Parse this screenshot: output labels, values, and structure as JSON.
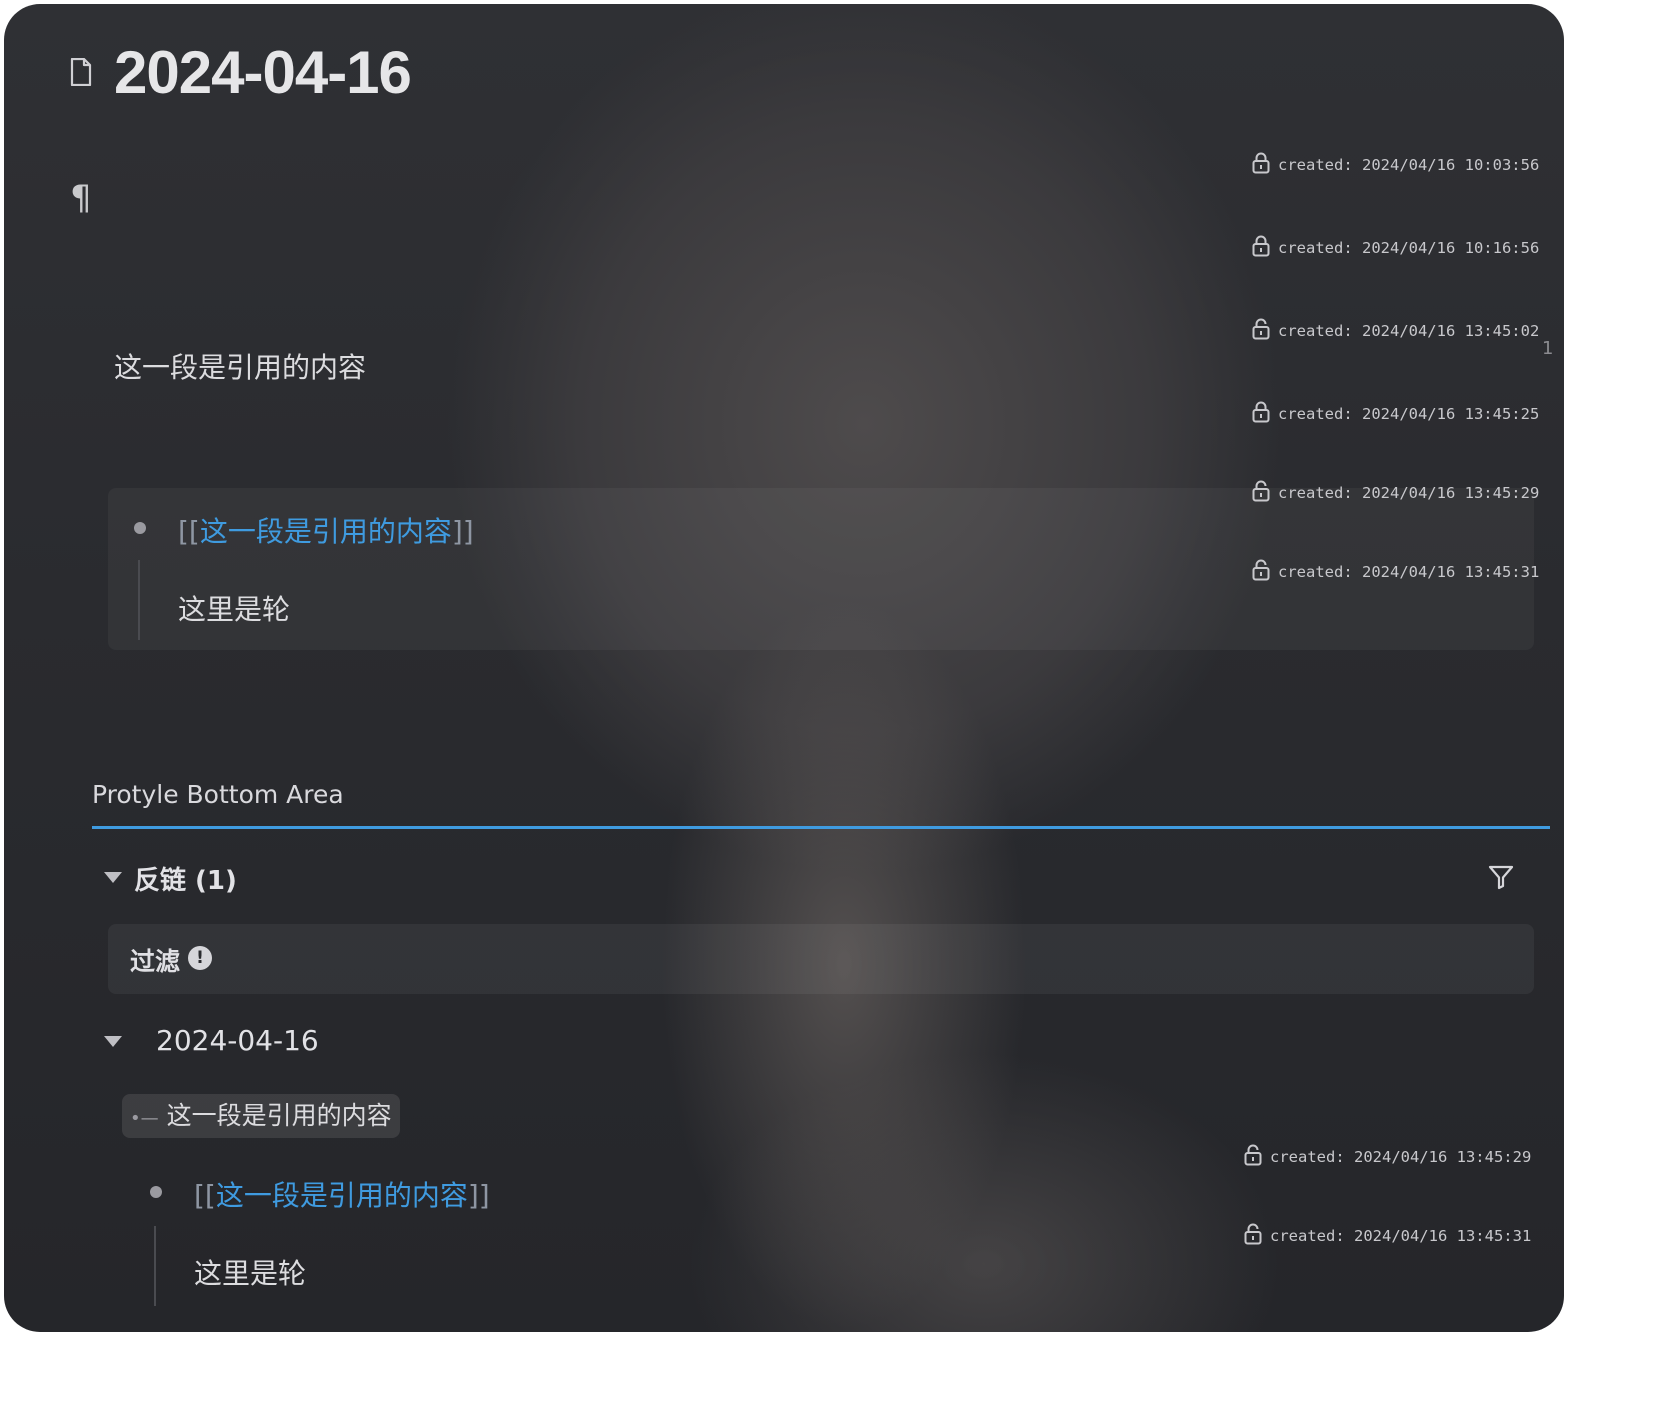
{
  "document": {
    "title": "2024-04-16",
    "paragraph_1": "这一段是引用的内容",
    "list": {
      "ref_open": "[[",
      "ref_text": "这一段是引用的内容",
      "ref_close": "]]",
      "child_text": "这里是轮"
    },
    "block_meta": [
      {
        "text": "created: 2024/04/16 10:03:56",
        "lock": "lock-closed"
      },
      {
        "text": "created: 2024/04/16 10:16:56",
        "lock": "lock-closed"
      },
      {
        "text": "created: 2024/04/16 13:45:02",
        "lock": "lock-open"
      },
      {
        "text": "created: 2024/04/16 13:45:25",
        "lock": "lock-closed"
      },
      {
        "text": "created: 2024/04/16 13:45:29",
        "lock": "lock-open"
      },
      {
        "text": "created: 2024/04/16 13:45:31",
        "lock": "lock-open"
      }
    ],
    "scroll_indicator": "1"
  },
  "bottom_area": {
    "title": "Protyle Bottom Area",
    "accent_color": "#3f9be0",
    "backlinks": {
      "title": "反链 (1)",
      "filter_label": "过滤",
      "filter_info_glyph": "!",
      "group_title": "2024-04-16",
      "breadcrumb_marker": "•—",
      "breadcrumb_text": "这一段是引用的内容",
      "item": {
        "ref_open": "[[",
        "ref_text": "这一段是引用的内容",
        "ref_close": "]]",
        "child_text": "这里是轮"
      },
      "block_meta": [
        {
          "text": "created: 2024/04/16 13:45:29",
          "lock": "lock-open"
        },
        {
          "text": "created: 2024/04/16 13:45:31",
          "lock": "lock-open"
        }
      ]
    }
  }
}
